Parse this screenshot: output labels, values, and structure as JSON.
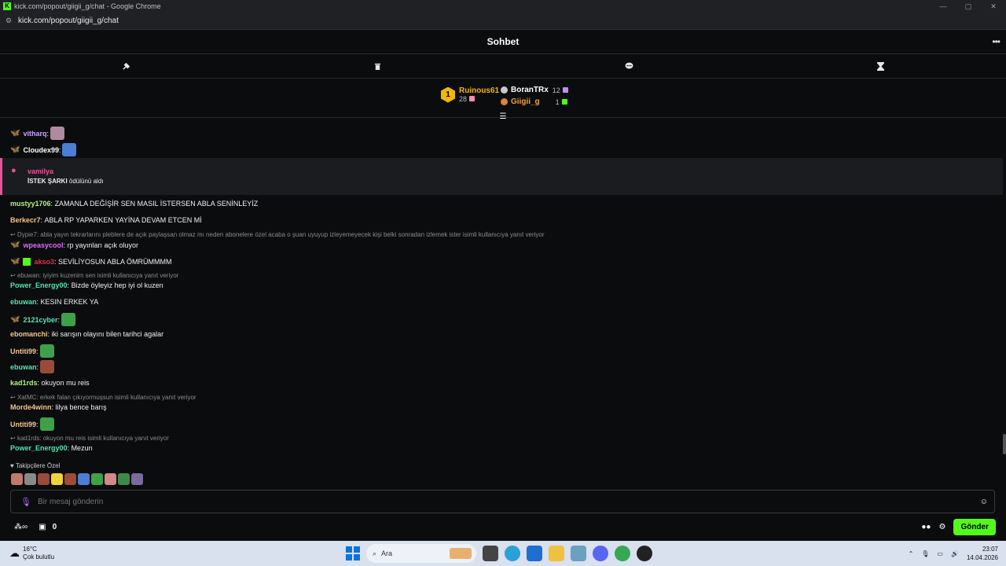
{
  "browser": {
    "window_title": "kick.com/popout/giigii_g/chat - Google Chrome",
    "url": "kick.com/popout/giigii_g/chat"
  },
  "header": {
    "title": "Sohbet"
  },
  "leaderboard": {
    "first": {
      "rank": "1",
      "name": "Ruinous61",
      "count": "28"
    },
    "second": {
      "name": "BoranTRx",
      "count": "12"
    },
    "third": {
      "name": "Giigii_g",
      "count": "1"
    }
  },
  "reward": {
    "user": "vamilya",
    "reward_name": "İSTEK ŞARKI",
    "suffix": " ödülünü aldı"
  },
  "messages": [
    {
      "user": "vitharq",
      "text": "",
      "color": "#c7a5ff"
    },
    {
      "user": "Cloudex99",
      "text": "",
      "color": "#ffffff"
    },
    {
      "user": "mustyy1706",
      "text": "ZAMANLA DEĞİŞİR SEN MASIL İSTERSEN ABLA SENİNLEYİZ",
      "color": "#b2f27a"
    },
    {
      "user": "Berkecr7",
      "text": "ABLA RP YAPARKEN YAYİNA DEVAM ETCEN Mİ",
      "color": "#f5c58f"
    },
    {
      "reply": "Dypie7: abla yayın tekrarlarını pleblere de açık paylaşsan olmaz mı neden abonelere özel acaba o şuan uyuyup izleyemeyecek kişi belki sonradan izlemek ister isimli kullanıcıya yanıt veriyor"
    },
    {
      "user": "wpeasycool",
      "text": "rp yayınları açık oluyor",
      "color": "#e068ff"
    },
    {
      "user": "akso3",
      "text": "SEVİLİYOSUN ABLA ÖMRÜMMMM",
      "color": "#e0304a"
    },
    {
      "reply": "ebuwan: iyiyim kuzenim sen isimli kullanıcıya yanıt veriyor"
    },
    {
      "user": "Power_Energy00",
      "text": "Bizde öyleyiz hep iyi ol kuzen",
      "color": "#53e6b0"
    },
    {
      "user": "ebuwan",
      "text": "KESIN ERKEK YA",
      "color": "#53e6b0"
    },
    {
      "user": "2121cyber",
      "text": "",
      "color": "#53e6b0"
    },
    {
      "user": "ebomanchi",
      "text": "iki sarışın olayını bilen tarihci agalar",
      "color": "#f5c58f"
    },
    {
      "user": "Untiti99",
      "text": "",
      "color": "#f5c58f"
    },
    {
      "user": "ebuwan",
      "text": "",
      "color": "#53e6b0"
    },
    {
      "user": "kad1rds",
      "text": "okuyon mu reis",
      "color": "#b2f27a"
    },
    {
      "reply": "XatMC: erkek falan çıkıyormuşsun isimli kullanıcıya yanıt veriyor"
    },
    {
      "user": "Morde4winn",
      "text": "lilya bence barış",
      "color": "#f5c58f"
    },
    {
      "user": "Untiti99",
      "text": "",
      "color": "#f5c58f"
    },
    {
      "reply": "kad1rds: okuyon mu reis isimli kullanıcıya yanıt veriyor"
    },
    {
      "user": "Power_Energy00",
      "text": "Mezun",
      "color": "#53e6b0"
    }
  ],
  "followers_label": "Takipçilere Özel",
  "input": {
    "placeholder": "Bir mesaj gönderin"
  },
  "bottom": {
    "points": "0",
    "send_label": "Gönder"
  },
  "taskbar": {
    "temp": "16°C",
    "weather": "Çok bulutlu",
    "search_placeholder": "Ara",
    "time": "23:07",
    "date": "14.04.2026"
  },
  "colors": {
    "accent": "#53fc18",
    "gold": "#f2b705",
    "reward": "#e8549a"
  }
}
